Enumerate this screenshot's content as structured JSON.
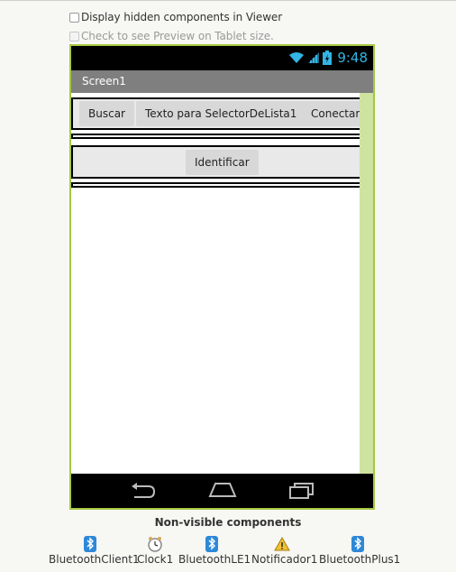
{
  "options": {
    "display_hidden": "Display hidden components in Viewer",
    "tablet_preview": "Check to see Preview on Tablet size."
  },
  "status_bar": {
    "time": "9:48"
  },
  "screen": {
    "title": "Screen1"
  },
  "row1": {
    "buscar": "Buscar",
    "selector": "Texto para SelectorDeLista1",
    "conectar": "Conectar"
  },
  "row2": {
    "identificar": "Identificar"
  },
  "non_visible": {
    "title": "Non-visible components",
    "items": [
      {
        "label": "BluetoothClient1",
        "icon": "bluetooth-icon"
      },
      {
        "label": "Clock1",
        "icon": "clock-icon"
      },
      {
        "label": "BluetoothLE1",
        "icon": "bluetooth-icon"
      },
      {
        "label": "Notificador1",
        "icon": "warning-icon"
      },
      {
        "label": "BluetoothPlus1",
        "icon": "bluetooth-icon"
      }
    ]
  },
  "colors": {
    "frame": "#a5c740",
    "time": "#33b5e5",
    "scrollbar": "#cfe3a0"
  }
}
